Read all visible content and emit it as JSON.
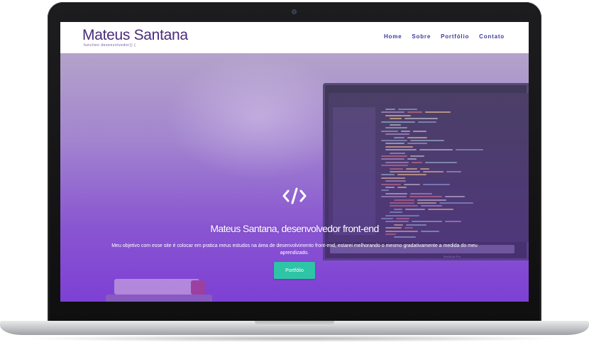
{
  "site": {
    "brand": "Mateus Santana",
    "tagline": "function desenvolvedor() {"
  },
  "nav": {
    "items": [
      {
        "label": "Home"
      },
      {
        "label": "Sobre"
      },
      {
        "label": "Portfólio"
      },
      {
        "label": "Contato"
      }
    ]
  },
  "hero": {
    "icon": "code-icon",
    "title": "Mateus Santana, desenvolvedor front-end",
    "text": "Meu objetivo com esse site é colocar em pratica meus estudos na área de desenvolvimento front-end, estarei melhorando o mesmo gradativamente a medida do meu aprendizado.",
    "button_label": "Portfólio",
    "laptop_label": "MacBook Pro"
  },
  "colors": {
    "brand": "#4a2b7c",
    "nav_link": "#3b3b9a",
    "hero_purple": "#7b3bd6",
    "button": "#2ec4a6"
  }
}
